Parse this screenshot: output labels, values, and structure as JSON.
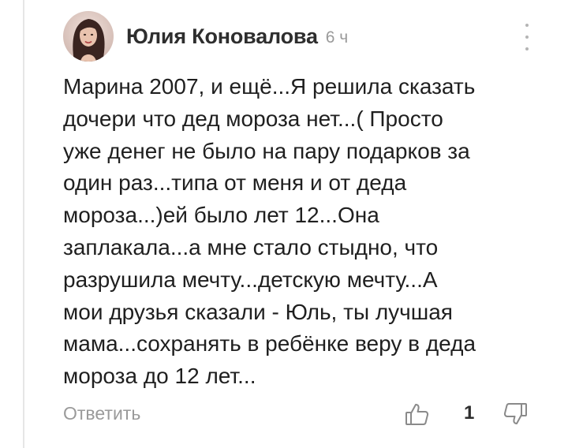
{
  "comment": {
    "author": "Юлия Коновалова",
    "time": "6 ч",
    "avatar_icon": "user-avatar-photo",
    "text": "Марина 2007, и ещё...Я решила сказать\nдочери что дед мороза нет...( Просто\nуже денег не было на пару подарков за\nодин раз...типа от меня и от деда\nмороза...)ей было лет 12...Она\nзаплакала...а мне стало стыдно, что\nразрушила мечту...детскую мечту...А\nмои друзья сказали - Юль, ты лучшая\nмама...сохранять в ребёнке веру в деда\nмороза до 12 лет..."
  },
  "actions": {
    "reply_label": "Ответить",
    "like_count": "1",
    "like_icon": "thumbs-up-icon",
    "dislike_icon": "thumbs-down-icon",
    "more_icon": "more-vertical-icon"
  },
  "colors": {
    "text": "#1f1f1f",
    "author": "#2e2e2e",
    "muted": "#9a9a9a",
    "thread_line": "#e6e6e6"
  }
}
